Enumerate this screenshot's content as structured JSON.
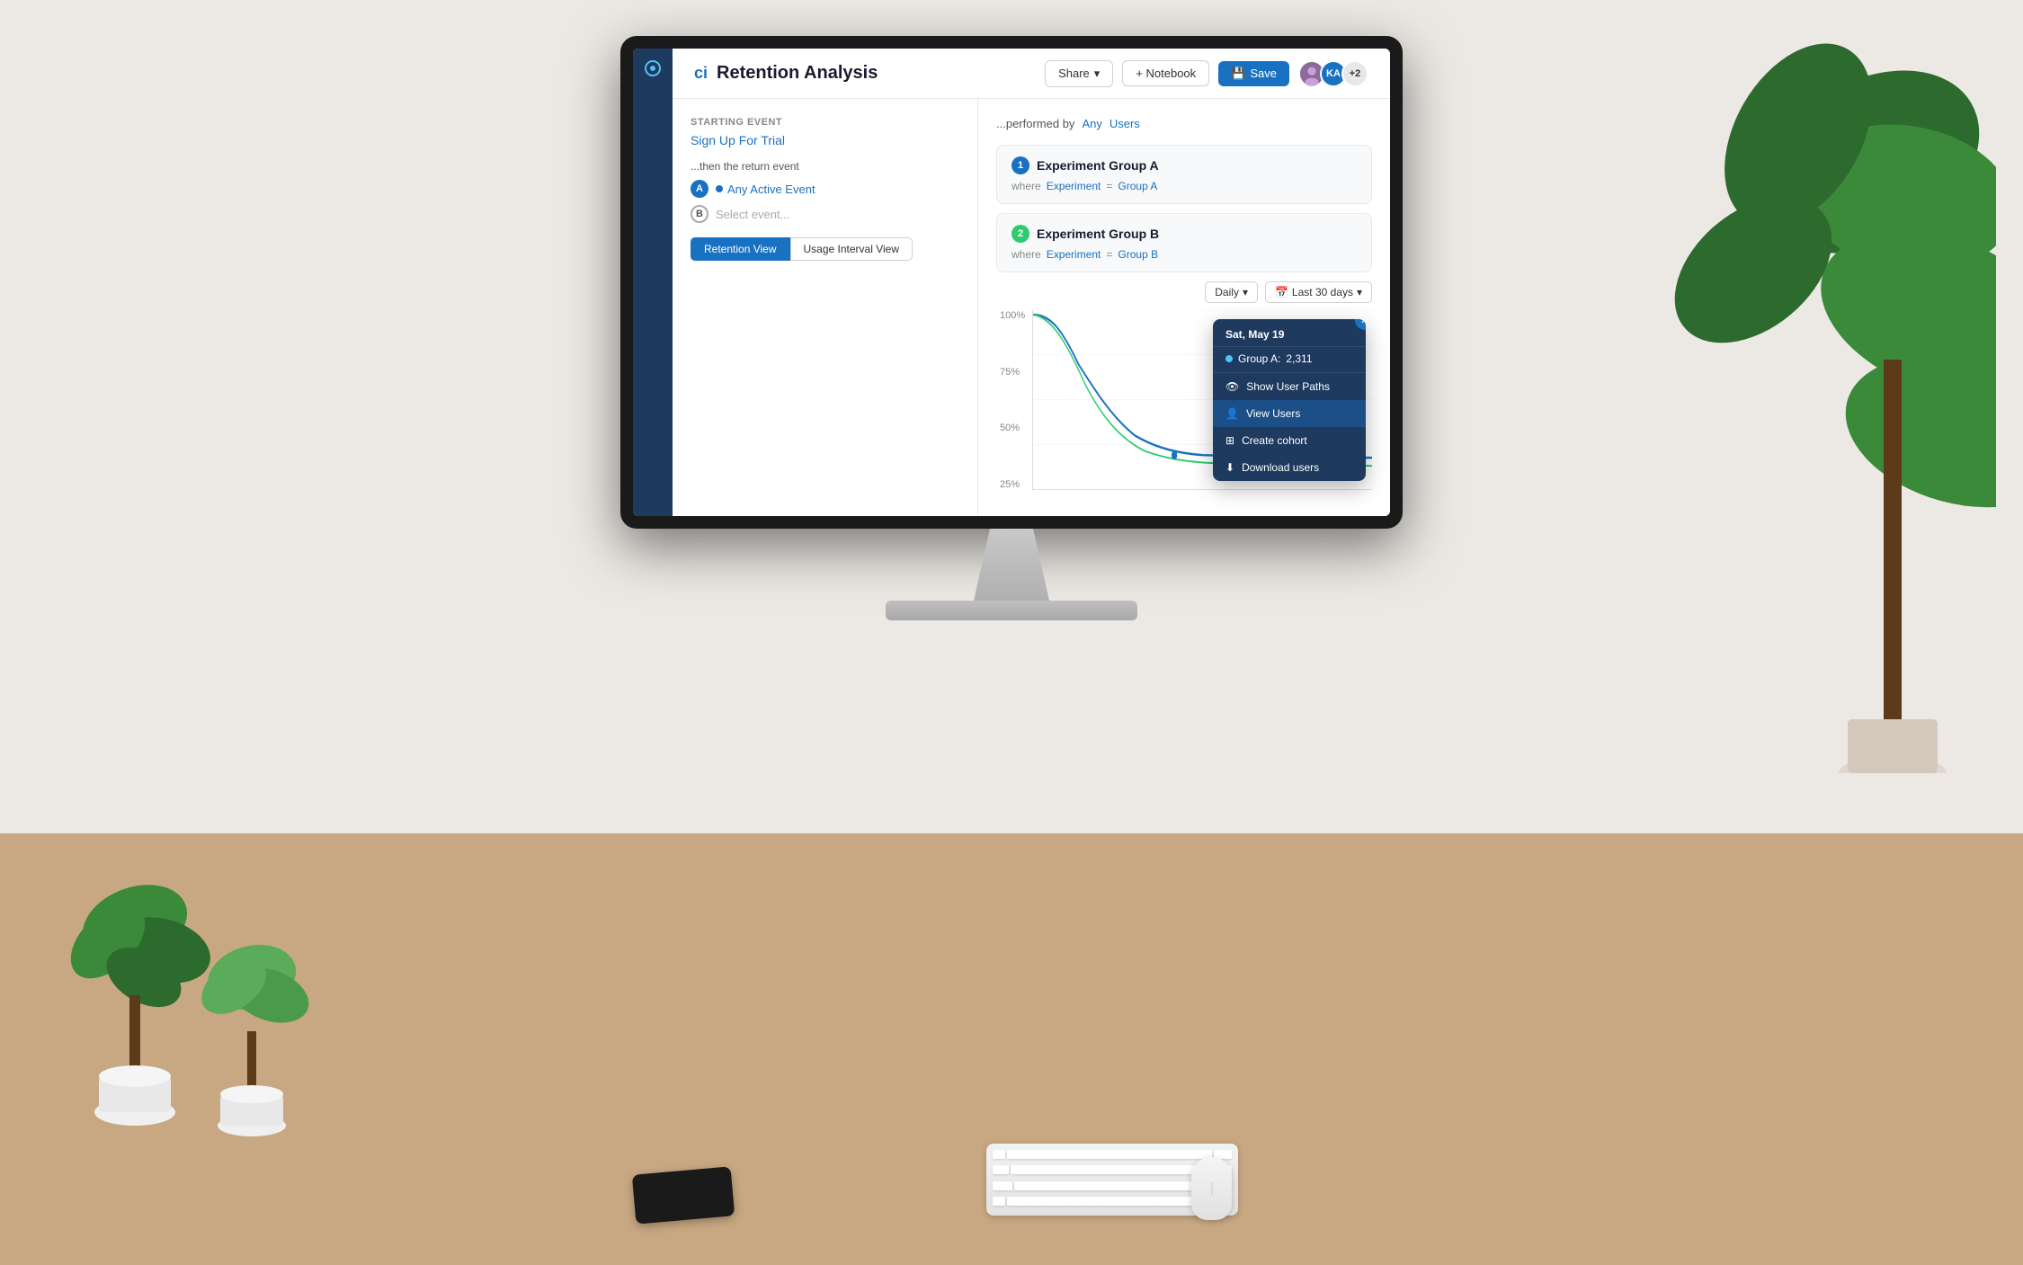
{
  "app": {
    "title": "Retention Analysis",
    "logo_text": "ci",
    "header": {
      "share_label": "Share",
      "notebook_label": "+ Notebook",
      "save_label": "Save",
      "avatar1_initials": "KA",
      "avatar_count": "+2"
    }
  },
  "left_panel": {
    "starting_event_label": "Starting Event",
    "starting_event_value": "Sign Up For Trial",
    "return_event_label": "...then the return event",
    "event_a_label": "A",
    "event_a_value": "Any Active Event",
    "event_b_label": "B",
    "event_b_placeholder": "Select event...",
    "view_toggle": {
      "retention_view": "Retention View",
      "usage_interval_view": "Usage Interval View"
    }
  },
  "right_panel": {
    "performed_by_label": "...performed by",
    "any_label": "Any",
    "users_label": "Users",
    "group_a": {
      "number": "1",
      "name": "Experiment Group A",
      "where_label": "where",
      "property": "Experiment",
      "operator": "=",
      "value": "Group A"
    },
    "group_b": {
      "number": "2",
      "name": "Experiment Group B",
      "where_label": "where",
      "property": "Experiment",
      "operator": "=",
      "value": "Group B"
    },
    "chart": {
      "time_filter": "Daily",
      "date_range": "Last 30 days",
      "y_labels": [
        "100%",
        "75%",
        "50%",
        "25%"
      ],
      "tooltip": {
        "date": "Sat, May 19",
        "group_a_label": "Group A:",
        "group_a_value": "2,311",
        "menu_items": [
          {
            "icon": "👁",
            "label": "Show User Paths"
          },
          {
            "icon": "👤",
            "label": "View Users"
          },
          {
            "icon": "⊞",
            "label": "Create cohort"
          },
          {
            "icon": "⬇",
            "label": "Download users"
          }
        ]
      }
    }
  }
}
